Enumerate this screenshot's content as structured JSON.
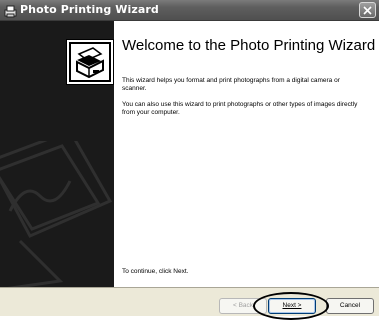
{
  "window": {
    "title": "Photo Printing Wizard",
    "icon": "printer-photo-icon",
    "close_icon": "close-icon"
  },
  "sidebar": {
    "logo_icon": "photo-printer-icon",
    "watermark_icon": "photo-watermark-icon"
  },
  "main": {
    "heading": "Welcome to the Photo Printing Wizard",
    "paragraph1": "This wizard helps you format and print photographs from a digital camera or scanner.",
    "paragraph2": "You can also use this wizard to print photographs or other types of images directly from your computer.",
    "continue_text": "To continue, click Next."
  },
  "buttons": {
    "back": "< Back",
    "next": "Next >",
    "cancel": "Cancel"
  },
  "colors": {
    "titlebar": "#5f5f5f",
    "sidebar": "#1a1a1a",
    "content_bg": "#ffffff",
    "bottombar": "#ece9d8"
  }
}
